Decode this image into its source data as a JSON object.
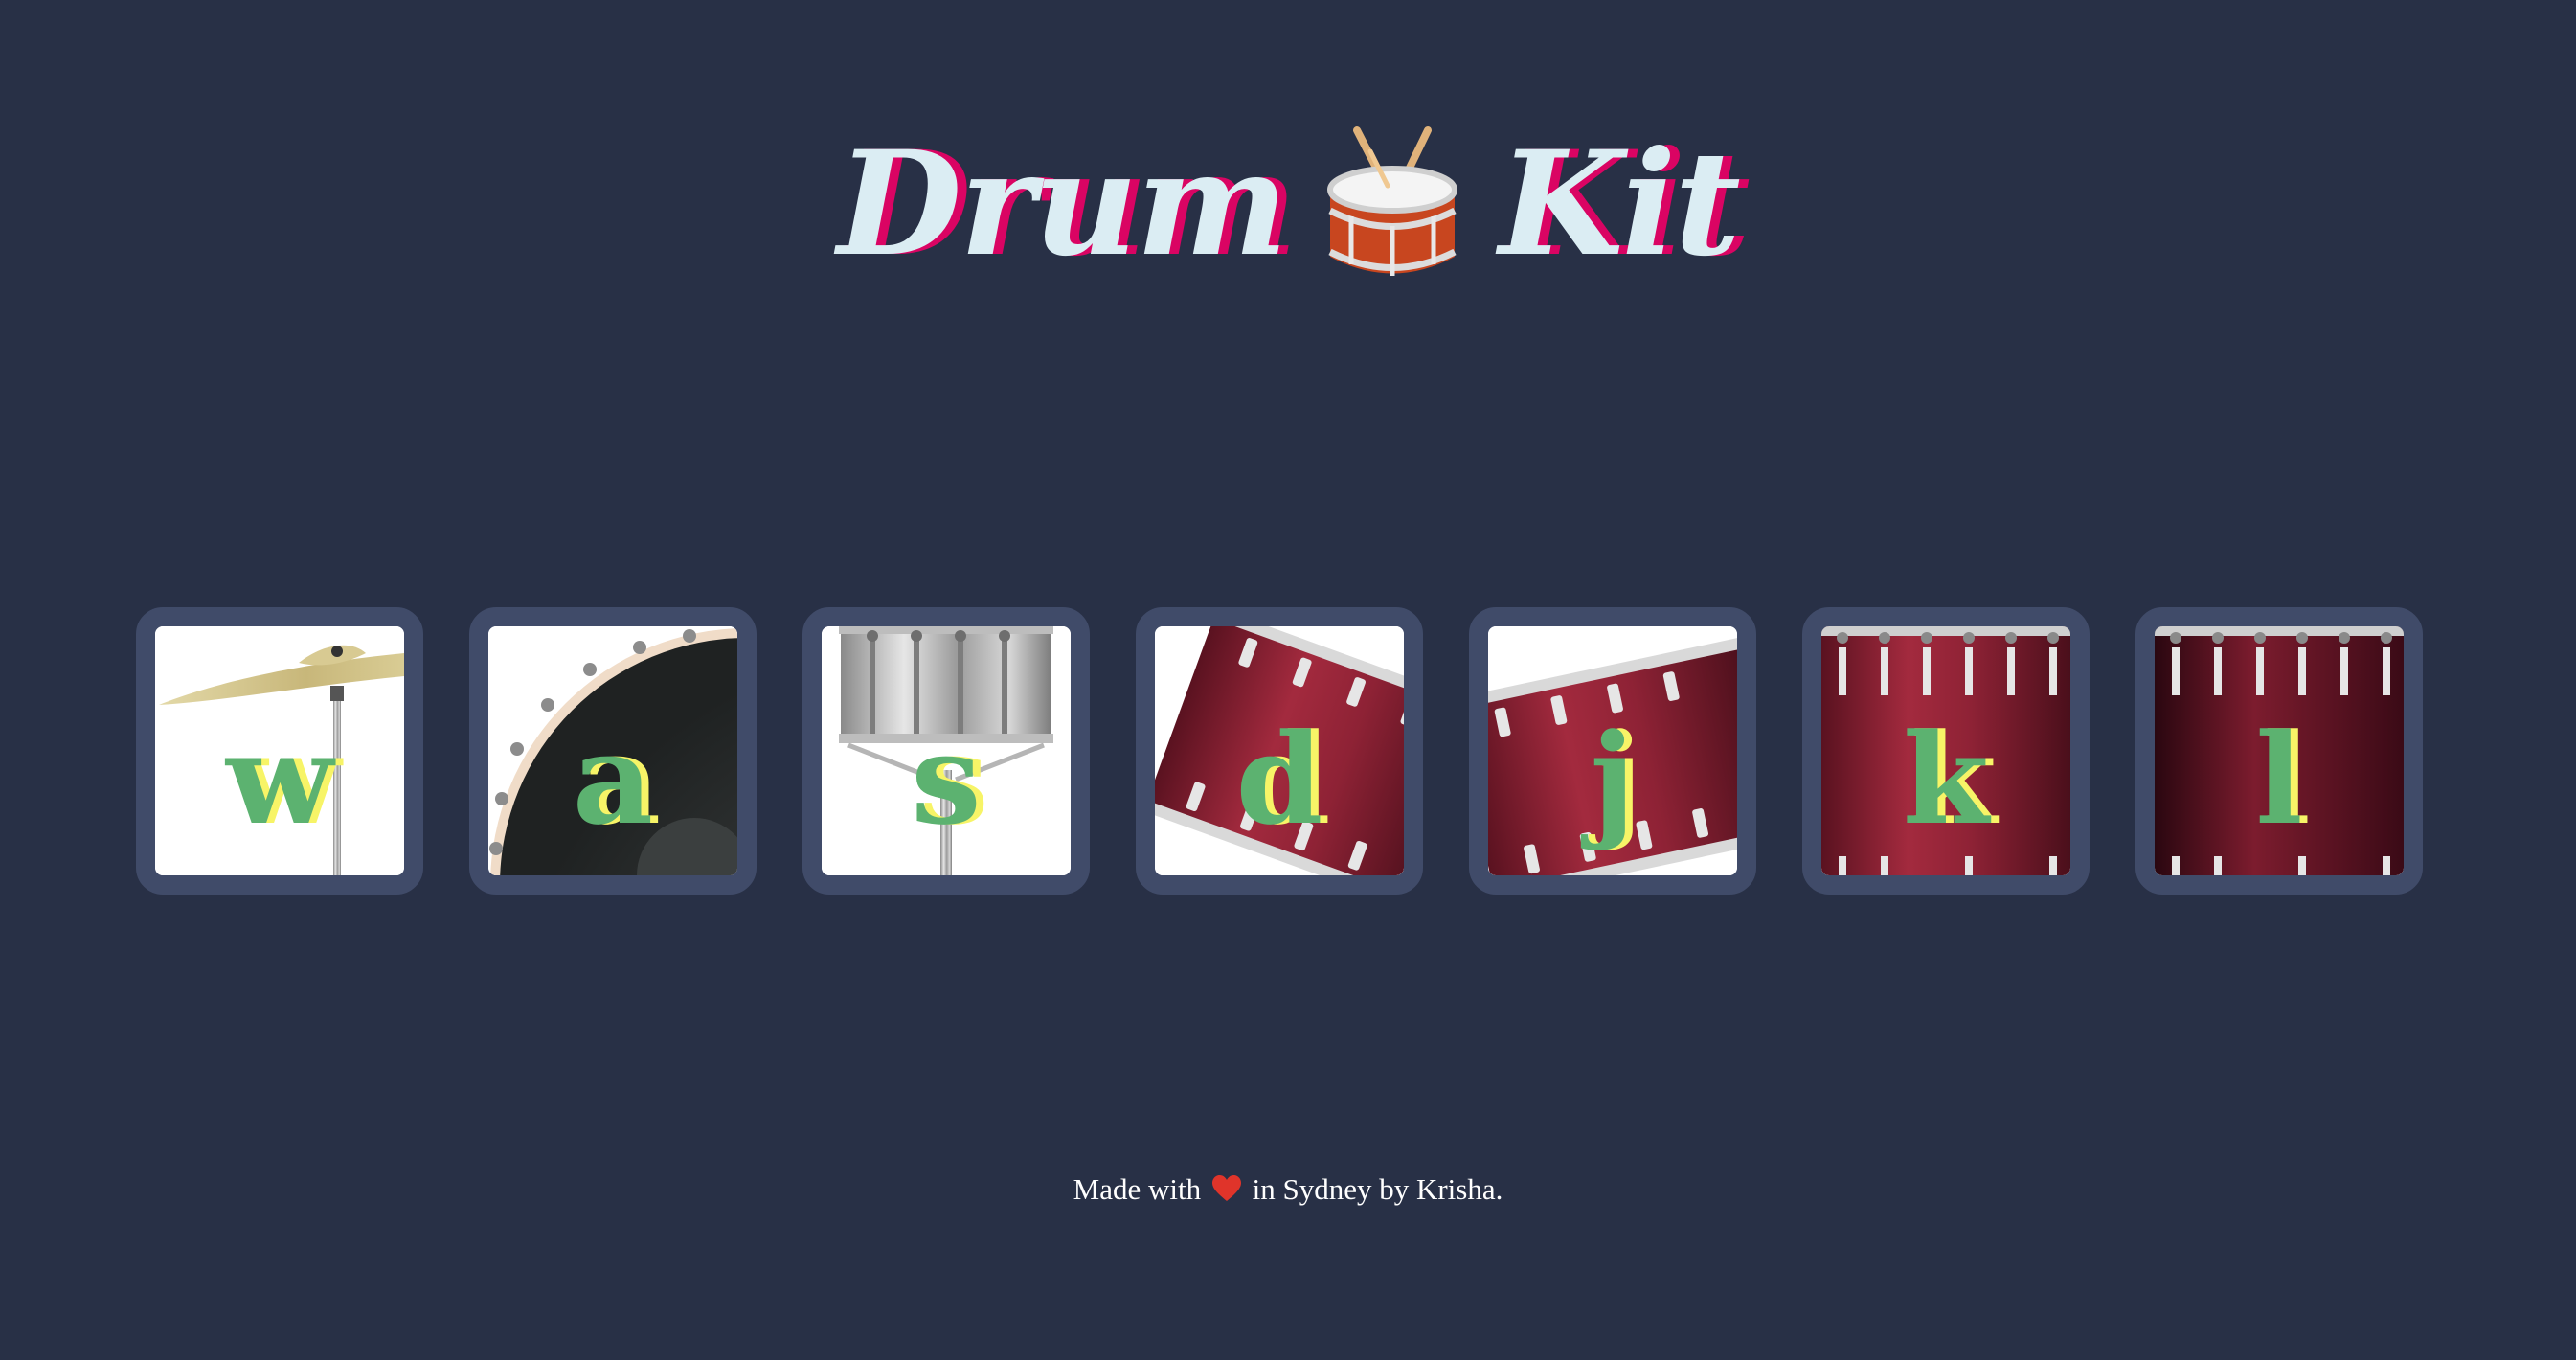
{
  "header": {
    "title_left": "Drum",
    "title_right": "Kit",
    "title_icon": "drum-emoji-icon"
  },
  "drums": [
    {
      "key": "w",
      "instrument_icon": "crash-cymbal-icon"
    },
    {
      "key": "a",
      "instrument_icon": "kick-bass-icon"
    },
    {
      "key": "s",
      "instrument_icon": "snare-icon"
    },
    {
      "key": "d",
      "instrument_icon": "tom-icon"
    },
    {
      "key": "j",
      "instrument_icon": "tom-icon"
    },
    {
      "key": "k",
      "instrument_icon": "tom-icon"
    },
    {
      "key": "l",
      "instrument_icon": "tom-icon"
    }
  ],
  "footer": {
    "text_before": "Made with",
    "text_after": "in Sydney by Krisha.",
    "heart_icon": "heart-icon"
  },
  "colors": {
    "background": "#283046",
    "button_border": "#404B69",
    "title_text": "#DBEDF3",
    "title_shadow": "#DA0463",
    "key_text": "#5CB270",
    "key_shadow": "#F7F467",
    "drum_red": "#A0283C"
  }
}
